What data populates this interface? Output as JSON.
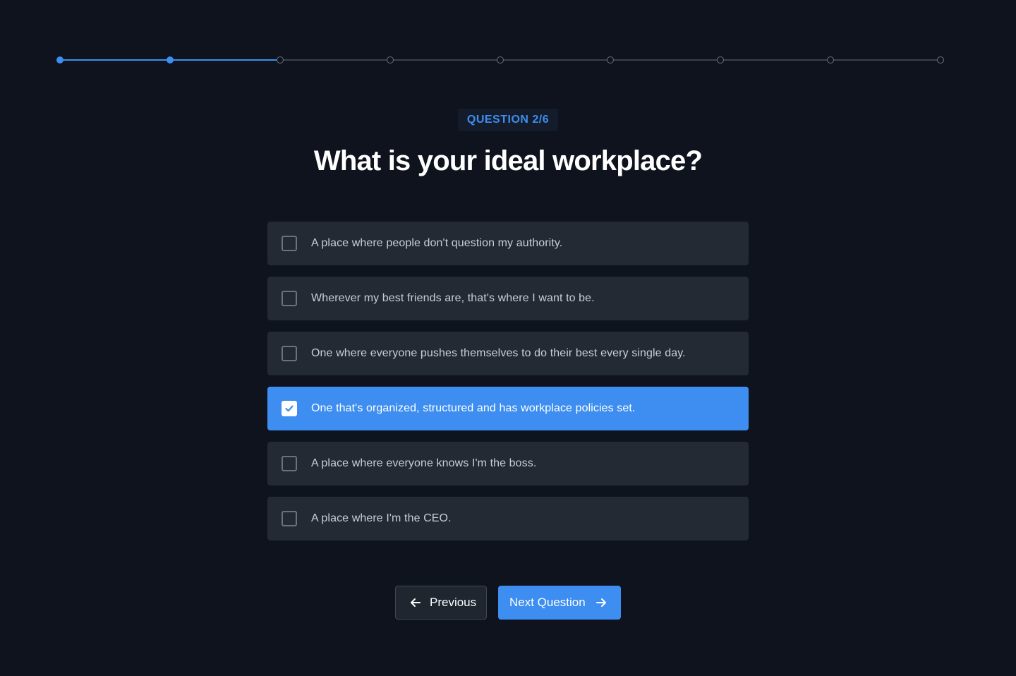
{
  "progress": {
    "total_steps": 9,
    "completed_steps": 2
  },
  "question": {
    "badge": "QUESTION 2/6",
    "title": "What is your ideal workplace?"
  },
  "options": [
    {
      "label": "A place where people don't question my authority.",
      "checked": false
    },
    {
      "label": "Wherever my best friends are, that's where I want to be.",
      "checked": false
    },
    {
      "label": "One where everyone pushes themselves to do their best every single day.",
      "checked": false
    },
    {
      "label": "One that's organized, structured and has workplace policies set.",
      "checked": true
    },
    {
      "label": "A place where everyone knows I'm the boss.",
      "checked": false
    },
    {
      "label": "A place where I'm the CEO.",
      "checked": false
    }
  ],
  "buttons": {
    "previous_label": "Previous",
    "previous_icon": "arrow-left-icon",
    "next_label": "Next Question",
    "next_icon": "arrow-right-icon"
  },
  "colors": {
    "background": "#0e131e",
    "accent": "#3d8ef0",
    "option_bg": "#232a33"
  }
}
